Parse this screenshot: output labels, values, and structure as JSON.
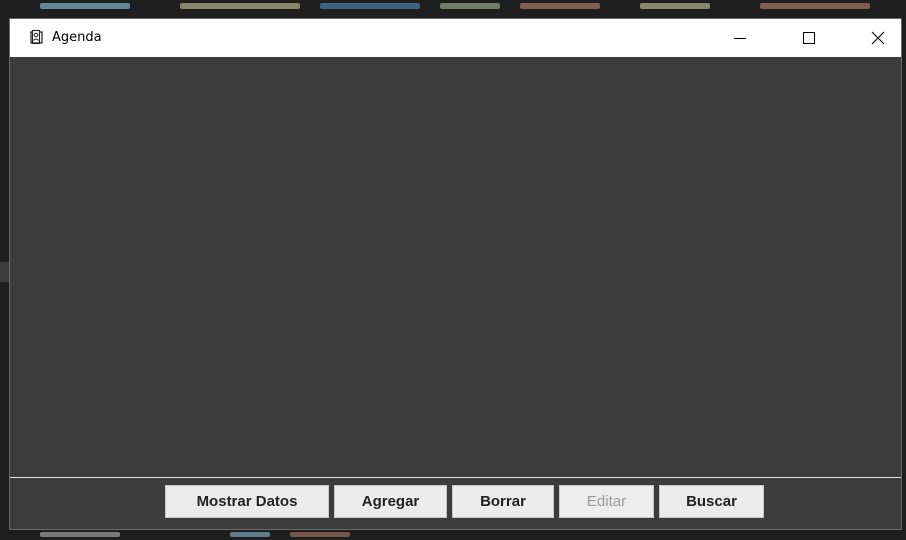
{
  "window": {
    "title": "Agenda"
  },
  "titlebar_controls": {
    "minimize_icon": "minimize-icon",
    "maximize_icon": "maximize-icon",
    "close_icon": "close-icon"
  },
  "buttons": {
    "show_data": "Mostrar Datos",
    "add": "Agregar",
    "delete": "Borrar",
    "edit": "Editar",
    "search": "Buscar"
  },
  "button_states": {
    "edit_enabled": false
  },
  "colors": {
    "window_background": "#3c3c3c",
    "titlebar": "#ffffff",
    "button_face": "#ececec",
    "disabled_text": "#9a9a9a"
  }
}
